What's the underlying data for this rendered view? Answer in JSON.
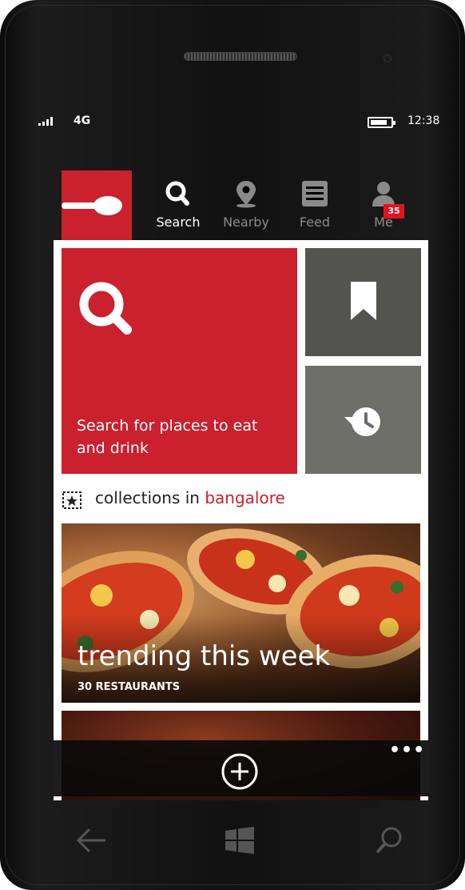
{
  "status_bar": {
    "network": "4G",
    "time": "12:38"
  },
  "app": {
    "brand_color": "#cb202d",
    "logo_icon": "spoon-icon"
  },
  "tabs": [
    {
      "label": "Search",
      "icon": "search-icon",
      "active": true
    },
    {
      "label": "Nearby",
      "icon": "location-pin-icon",
      "active": false
    },
    {
      "label": "Feed",
      "icon": "feed-list-icon",
      "active": false
    },
    {
      "label": "Me",
      "icon": "user-icon",
      "active": false,
      "badge": "35"
    }
  ],
  "tiles": {
    "search_text": "Search for places to eat and drink",
    "bookmark_icon": "bookmark-icon",
    "history_icon": "history-icon"
  },
  "collections": {
    "prefix": "collections in ",
    "city": "bangalore"
  },
  "cards": [
    {
      "title": "trending this week",
      "subtitle": "30 RESTAURANTS"
    }
  ],
  "app_bar": {
    "add_icon": "add-circle-icon",
    "more_label": "•••"
  }
}
